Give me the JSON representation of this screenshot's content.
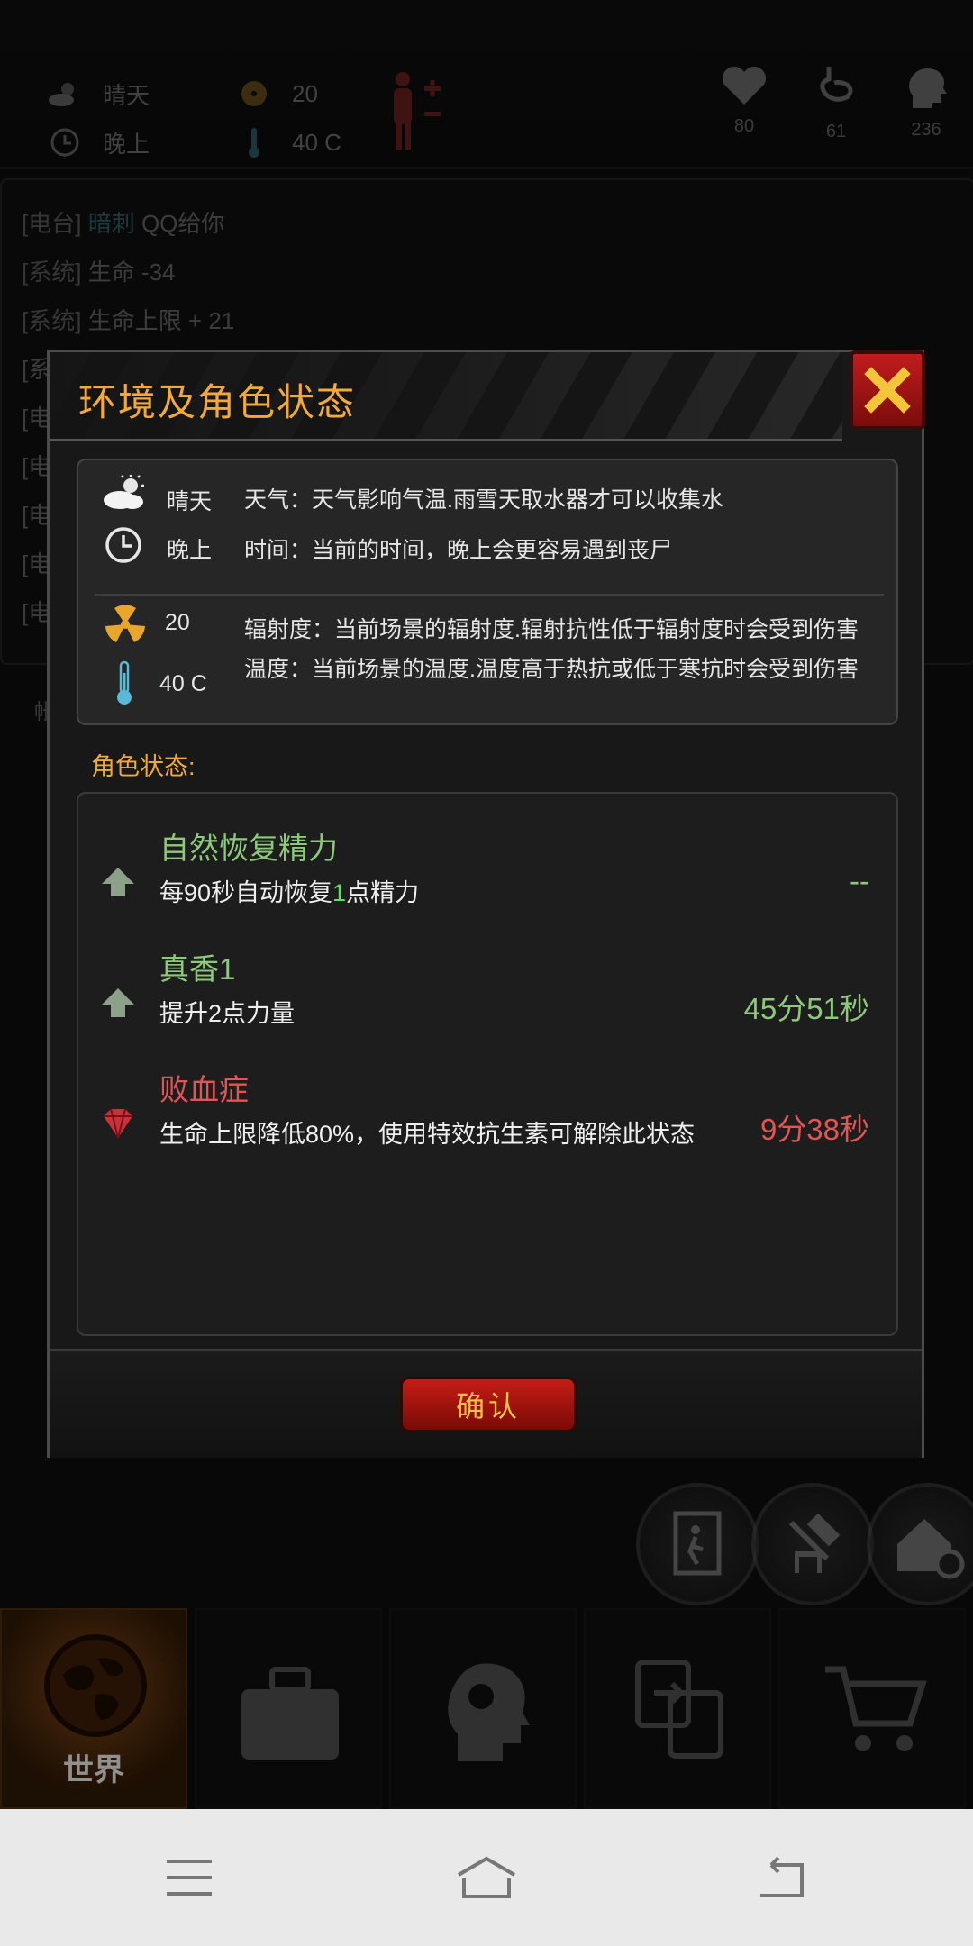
{
  "topbar": {
    "weather": "晴天",
    "time": "晚上",
    "radiation": "20",
    "temperature": "40 C",
    "stats": [
      {
        "icon": "heart-icon",
        "value": "80"
      },
      {
        "icon": "stomach-icon",
        "value": "61"
      },
      {
        "icon": "brain-head-icon",
        "value": "236"
      }
    ]
  },
  "log": {
    "lines": [
      {
        "tag": "[电台]",
        "highlight": "暗刺",
        "text": "QQ给你"
      },
      {
        "tag": "[系统]",
        "highlight": "",
        "text": "生命 -34"
      },
      {
        "tag": "[系统]",
        "highlight": "",
        "text": "生命上限 + 21"
      }
    ],
    "partial_prefix": [
      "[系",
      "[电",
      "[电",
      "[电",
      "[电",
      "[电"
    ],
    "side_label": "帐"
  },
  "modal": {
    "title": "环境及角色状态",
    "env": {
      "weather_value": "晴天",
      "weather_desc": "天气：天气影响气温.雨雪天取水器才可以收集水",
      "time_value": "晚上",
      "time_desc": "时间：当前的时间，晚上会更容易遇到丧尸",
      "radiation_value": "20",
      "radiation_desc": "辐射度：当前场景的辐射度.辐射抗性低于辐射度时会受到伤害",
      "temperature_value": "40 C",
      "temperature_desc": "温度：当前场景的温度.温度高于热抗或低于寒抗时会受到伤害"
    },
    "status_label": "角色状态:",
    "statuses": [
      {
        "name": "自然恢复精力",
        "desc_pre": "每90秒自动恢复",
        "desc_num": "1",
        "desc_post": "点精力",
        "time": "--",
        "color": "#8dc97a"
      },
      {
        "name": "真香1",
        "desc_pre": "提升2点力量",
        "desc_num": "",
        "desc_post": "",
        "time": "45分51秒",
        "color": "#8dc97a"
      },
      {
        "name": "败血症",
        "desc_pre": "生命上限降低80%，使用特效抗生素可解除此状态",
        "desc_num": "",
        "desc_post": "",
        "time": "9分38秒",
        "color": "#e05555"
      }
    ],
    "confirm_label": "确认"
  },
  "tabs": [
    {
      "label": "世界",
      "icon": "globe-icon"
    },
    {
      "label": "",
      "icon": "suitcase-icon"
    },
    {
      "label": "",
      "icon": "head-gear-icon"
    },
    {
      "label": "",
      "icon": "exchange-icon"
    },
    {
      "label": "",
      "icon": "cart-icon"
    }
  ],
  "navbar": {
    "menu": "menu-icon",
    "home": "home-icon",
    "back": "back-icon"
  }
}
